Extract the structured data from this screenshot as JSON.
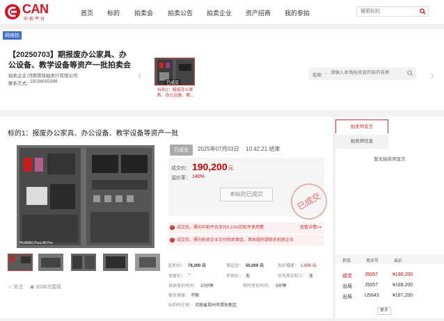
{
  "header": {
    "logo_text": "CAN",
    "logo_sub": "中拍平台",
    "nav": [
      "首页",
      "标的",
      "拍卖会",
      "拍卖公告",
      "拍卖企业",
      "资产招商",
      "我的参拍"
    ],
    "search_placeholder": "搜索标的"
  },
  "auction": {
    "badge": "网络拍",
    "title": "【20250703】期报废办公家具、办公设备、教学设备等资产一批拍卖会",
    "company_label": "拍卖企业：",
    "company": "河南铁铭拍卖行有限公司",
    "contact_label": "联系方式：",
    "contact": "15036005398",
    "thumb_caption": "标的1：报废办公家具、办公设备、教...",
    "thumb_badge": "已成交",
    "name_label": "名称",
    "name_placeholder": "请输入本场拍卖会的标的名称"
  },
  "lot": {
    "title": "标的1：报废办公家具、办公设备、教学设备等资产一批",
    "status": "已成交",
    "end_date": "2025年07月03日",
    "end_time": "10:42:21 结束",
    "price_label": "成交价：",
    "price": "190,200",
    "price_unit": "元",
    "premium_label": "溢价率：",
    "premium": "140%",
    "closed_button": "本标的已成交",
    "stamp": "已成交",
    "notice1": "成交后，需向中拍平台支付0.15%的软件使用费",
    "notice1_link": "查看详情>>",
    "notice2": "成交后，需向拍卖企业另付拍卖佣金，具体规则请联系拍卖企业",
    "img_watermark": "HUAWEI Pura 80 Pro",
    "follow_label": "关注",
    "views": "3038次围观",
    "details": {
      "start_price_label": "起拍价：",
      "start_price": "79,200 元",
      "deposit_label": "保证金：",
      "deposit": "50,000 元",
      "increment_label": "加价幅度：",
      "increment": "1,000 元",
      "reserve_label": "保留价：",
      "reserve": "--",
      "evaluation_label": "评估价：",
      "evaluation": "无",
      "priority_label": "优先购买权人：",
      "priority": "无",
      "free_bid_label": "自由竞价时间：",
      "free_bid": "10分钟",
      "time_limit_label": "限时竞价时间：",
      "time_limit": "3分钟",
      "hidden_label": "报名保留：",
      "hidden": "不限",
      "location_label": "标的所在地：",
      "location": "河南省郑州市郑东新区"
    }
  },
  "right_panel": {
    "tab_announcement": "拍卖师宣言",
    "tab_info": "拍卖师信息",
    "empty_text": "暂无拍卖师宣言",
    "col_status": "状态",
    "col_bidder": "竞买号",
    "col_price": "出价",
    "bids": [
      {
        "status": "成交",
        "bidder": "J5057",
        "price": "¥190,200"
      },
      {
        "status": "出局",
        "bidder": "J5057",
        "price": "¥188,200"
      },
      {
        "status": "出局",
        "bidder": "U5643",
        "price": "¥187,200"
      }
    ],
    "more": "更多"
  },
  "colors": {
    "brand_red": "#cc0000",
    "badge_blue": "#3a6fc4",
    "bg_gray": "#f2f2f2"
  }
}
